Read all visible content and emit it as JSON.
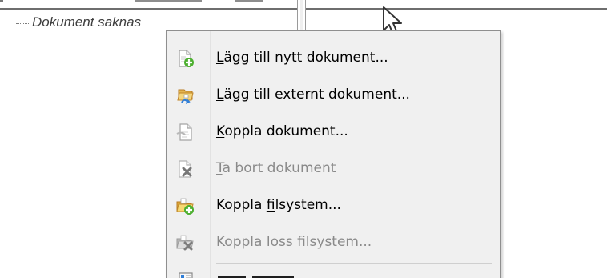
{
  "tree": {
    "item_label": "Dokument saknas"
  },
  "context_menu": {
    "items": [
      {
        "prefix": "",
        "mnemonic": "L",
        "suffix": "ägg till nytt dokument...",
        "enabled": true,
        "icon": "new-document-icon"
      },
      {
        "prefix": "",
        "mnemonic": "L",
        "suffix": "ägg till externt dokument...",
        "enabled": true,
        "icon": "external-document-icon"
      },
      {
        "prefix": "",
        "mnemonic": "K",
        "suffix": "oppla dokument...",
        "enabled": true,
        "icon": "link-document-icon"
      },
      {
        "prefix": "",
        "mnemonic": "T",
        "suffix": "a bort dokument",
        "enabled": false,
        "icon": "remove-document-icon"
      },
      {
        "prefix": "Koppla ",
        "mnemonic": "f",
        "suffix": "ilsystem...",
        "enabled": true,
        "icon": "connect-filesystem-icon"
      },
      {
        "prefix": "Koppla ",
        "mnemonic": "l",
        "suffix": "oss filsystem...",
        "enabled": false,
        "icon": "disconnect-filesystem-icon"
      }
    ]
  },
  "colors": {
    "menu_background": "#f0f0f0",
    "menu_border": "#8f8f8f",
    "enabled_text": "#000000",
    "disabled_text": "#8a8a8a",
    "tree_text": "#3e3e3e"
  }
}
